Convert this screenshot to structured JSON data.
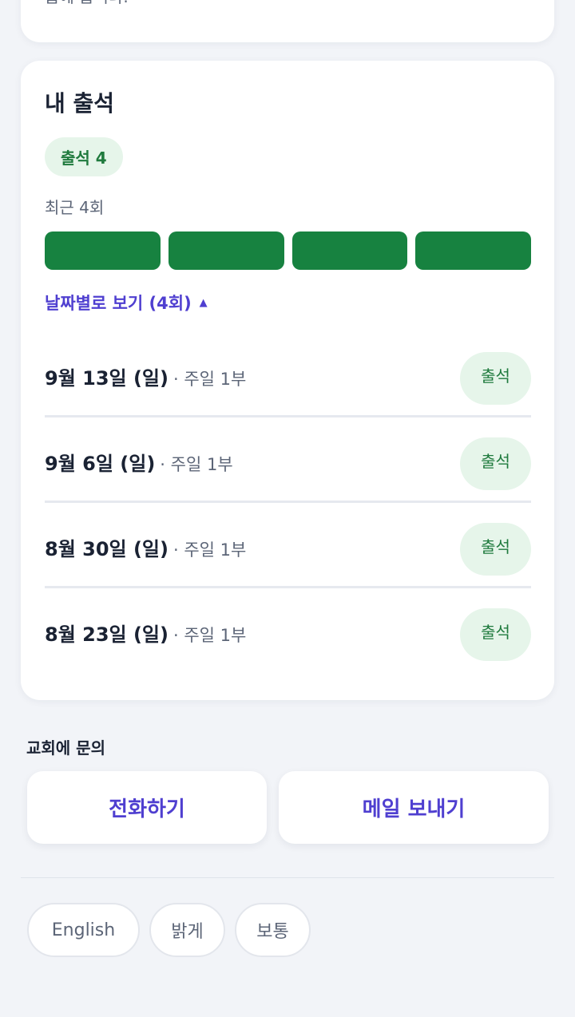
{
  "top_card": {
    "cut_text": "습에 습니다."
  },
  "attendance": {
    "title": "내 출석",
    "count_badge": "출석 4",
    "recent_label": "최근 4회",
    "recent_bars": [
      {
        "status": "attended",
        "color": "#178240"
      },
      {
        "status": "attended",
        "color": "#178240"
      },
      {
        "status": "attended",
        "color": "#178240"
      },
      {
        "status": "attended",
        "color": "#178240"
      }
    ],
    "toggle_label": "날짜별로 보기 (4회)",
    "toggle_caret": "▲",
    "rows": [
      {
        "date": "9월 13일 (일)",
        "service": "· 주일 1부",
        "status": "출석"
      },
      {
        "date": "9월 6일 (일)",
        "service": "· 주일 1부",
        "status": "출석"
      },
      {
        "date": "8월 30일 (일)",
        "service": "· 주일 1부",
        "status": "출석"
      },
      {
        "date": "8월 23일 (일)",
        "service": "· 주일 1부",
        "status": "출석"
      }
    ]
  },
  "contact": {
    "heading": "교회에 문의",
    "call_label": "전화하기",
    "mail_label": "메일 보내기"
  },
  "settings": {
    "language": "English",
    "theme": "밝게",
    "text_size": "보통"
  },
  "colors": {
    "accent": "#4f3fd0",
    "attended": "#178240",
    "attended_bg": "#e6f5ea",
    "background": "#f2f4f8"
  }
}
